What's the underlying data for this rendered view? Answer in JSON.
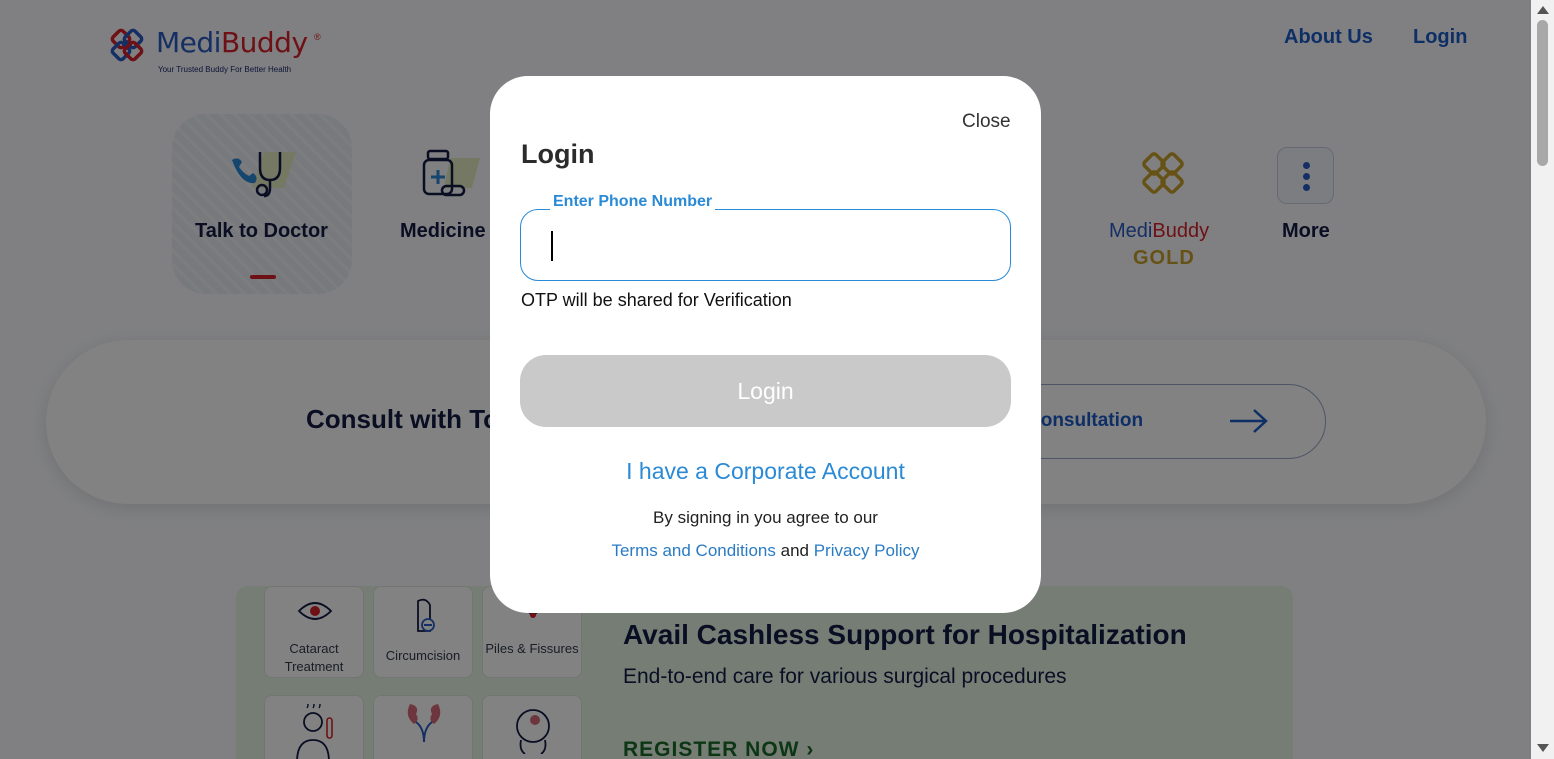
{
  "header": {
    "logo": {
      "brand_part1": "Medi",
      "brand_part2": "Buddy",
      "registered": "®",
      "tagline": "Your Trusted Buddy For Better Health"
    },
    "nav": {
      "about_label": "About Us",
      "login_label": "Login"
    }
  },
  "services": {
    "items": [
      {
        "label": "Talk to Doctor",
        "icon": "stethoscope-phone-icon",
        "active": true
      },
      {
        "label": "Medicine",
        "icon": "medicine-bottle-icon"
      }
    ],
    "gold": {
      "line1_part1": "Medi",
      "line1_part2": "Buddy",
      "line2": "GOLD",
      "icon": "medibuddy-gold-logo-icon"
    },
    "more": {
      "label": "More",
      "icon": "vertical-dots-icon"
    }
  },
  "consult_banner": {
    "text": "Consult with To",
    "button_label": "rt Consultation",
    "icon": "arrow-right-icon"
  },
  "cashless_banner": {
    "tiles": [
      {
        "label": "Cataract Treatment",
        "icon": "eye-icon"
      },
      {
        "label": "Circumcision",
        "icon": "circumcision-icon"
      },
      {
        "label": "Piles & Fissures",
        "icon": "piles-icon"
      },
      {
        "label": "",
        "icon": "fever-person-icon"
      },
      {
        "label": "",
        "icon": "kidney-icon"
      },
      {
        "label": "",
        "icon": "head-icon"
      }
    ],
    "title": "Avail Cashless Support for Hospitalization",
    "subtitle": "End-to-end care for various surgical procedures",
    "cta": "REGISTER NOW"
  },
  "login_modal": {
    "close_label": "Close",
    "title": "Login",
    "phone_label": "Enter Phone Number",
    "phone_value": "",
    "otp_note": "OTP will be shared for Verification",
    "login_button": "Login",
    "corporate_link": "I have a Corporate Account",
    "agree_text": "By signing in you agree to our",
    "terms_link": "Terms and Conditions",
    "and_text": "and",
    "privacy_link": "Privacy Policy"
  },
  "colors": {
    "brand_blue": "#2a5cc4",
    "brand_red": "#d6232b",
    "link_blue": "#2a8ad6",
    "disabled_button": "#c9c9c9",
    "gold": "#c9a12a",
    "cashless_green": "#1b6b2a"
  }
}
